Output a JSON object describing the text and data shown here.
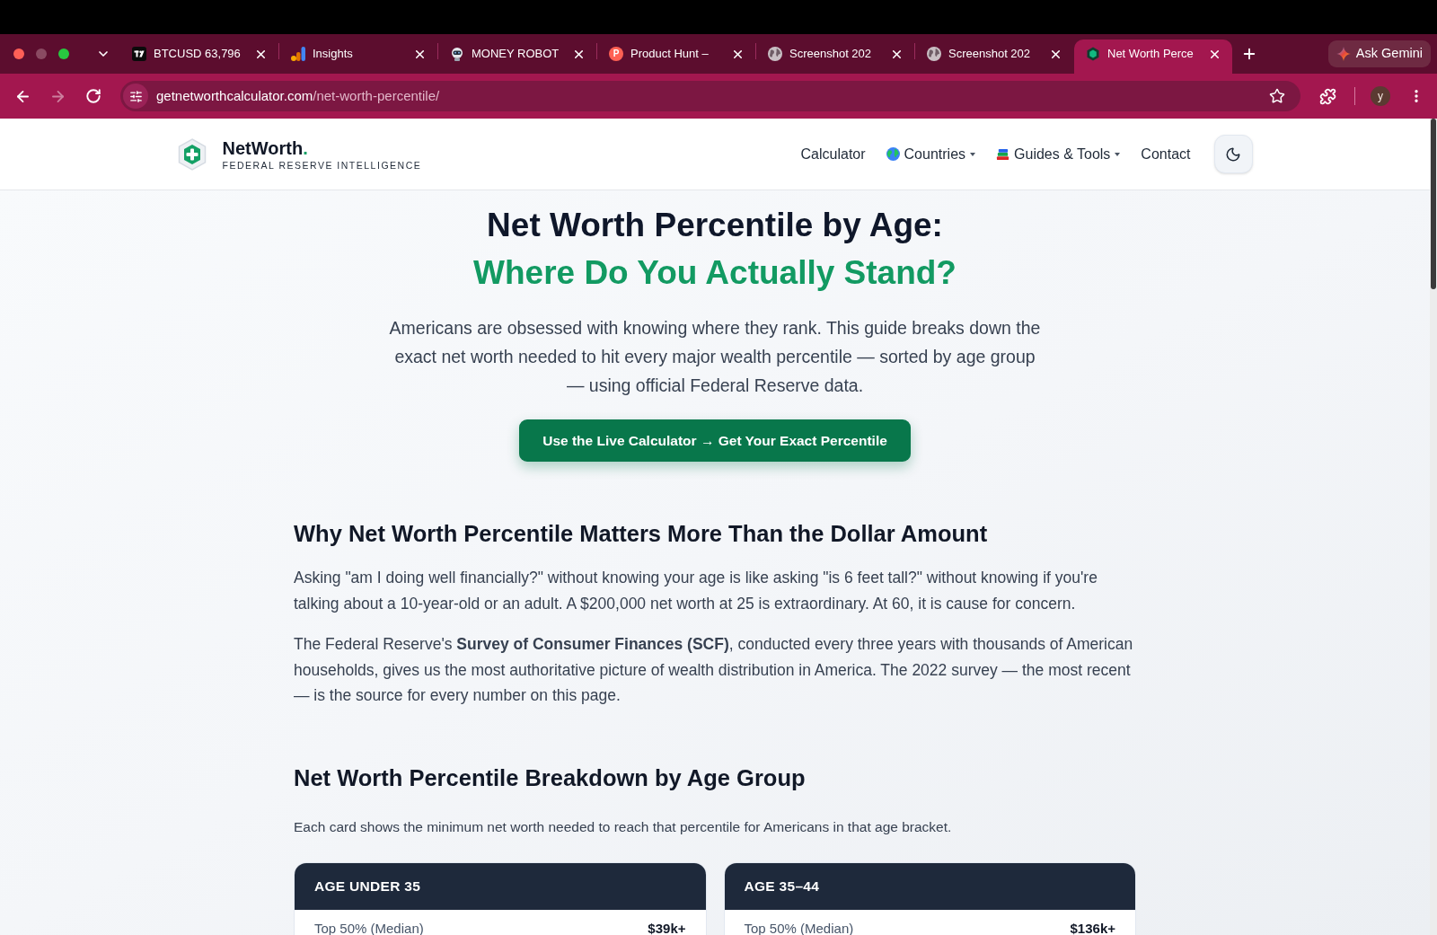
{
  "browser": {
    "tabs": [
      {
        "title": "BTCUSD 63,796",
        "kind": "tile",
        "selected": false
      },
      {
        "title": "Insights",
        "kind": "bars",
        "selected": false
      },
      {
        "title": "MONEY ROBOT",
        "kind": "robot",
        "selected": false
      },
      {
        "title": "Product Hunt –",
        "kind": "letter",
        "favicon_text": "P",
        "selected": false
      },
      {
        "title": "Screenshot 202",
        "kind": "globe",
        "selected": false
      },
      {
        "title": "Screenshot 202",
        "kind": "globe",
        "selected": false
      },
      {
        "title": "Net Worth Perce",
        "kind": "hex",
        "selected": true
      }
    ],
    "gemini_button": "Ask Gemini",
    "address": {
      "host": "getnetworthcalculator.com",
      "path": "/net-worth-percentile/"
    },
    "forward_disabled": true,
    "profile_initial": "y"
  },
  "site_header": {
    "brand": {
      "name": "NetWorth",
      "name_mark": ".",
      "tagline": "FEDERAL RESERVE INTELLIGENCE"
    },
    "nav": [
      {
        "label": "Calculator",
        "dropdown": false
      },
      {
        "label": "Countries",
        "dropdown": true
      },
      {
        "label": "Guides & Tools",
        "dropdown": true
      },
      {
        "label": "Contact",
        "dropdown": false
      }
    ]
  },
  "hero": {
    "title": "Net Worth Percentile by Age:",
    "title_highlight": "Where Do You Actually Stand?",
    "intro": "Americans are obsessed with knowing where they rank. This guide breaks down the exact net worth needed to hit every major wealth percentile — sorted by age group — using official Federal Reserve data.",
    "cta": "Use the Live Calculator → Get Your Exact Percentile"
  },
  "sections": [
    {
      "heading": "Why Net Worth Percentile Matters More Than the Dollar Amount",
      "paragraphs": [
        "Asking \"am I doing well financially?\" without knowing your age is like asking \"is 6 feet tall?\" without knowing if you're talking about a 10-year-old or an adult. A $200,000 net worth at 25 is extraordinary. At 60, it is cause for concern.",
        "The Federal Reserve's **Survey of Consumer Finances (SCF)**, conducted every three years with thousands of American households, gives us the most authoritative picture of wealth distribution in America. The 2022 survey — the most recent — is the source for every number on this page."
      ]
    },
    {
      "heading": "Net Worth Percentile Breakdown by Age Group",
      "caption": "Each card shows the minimum net worth needed to reach that percentile for Americans in that age bracket.",
      "cards": [
        {
          "title": "AGE UNDER 35",
          "rows": [
            {
              "label": "Top 50% (Median)",
              "value": "$39k+"
            }
          ]
        },
        {
          "title": "AGE 35–44",
          "rows": [
            {
              "label": "Top 50% (Median)",
              "value": "$136k+"
            }
          ]
        }
      ]
    }
  ]
}
